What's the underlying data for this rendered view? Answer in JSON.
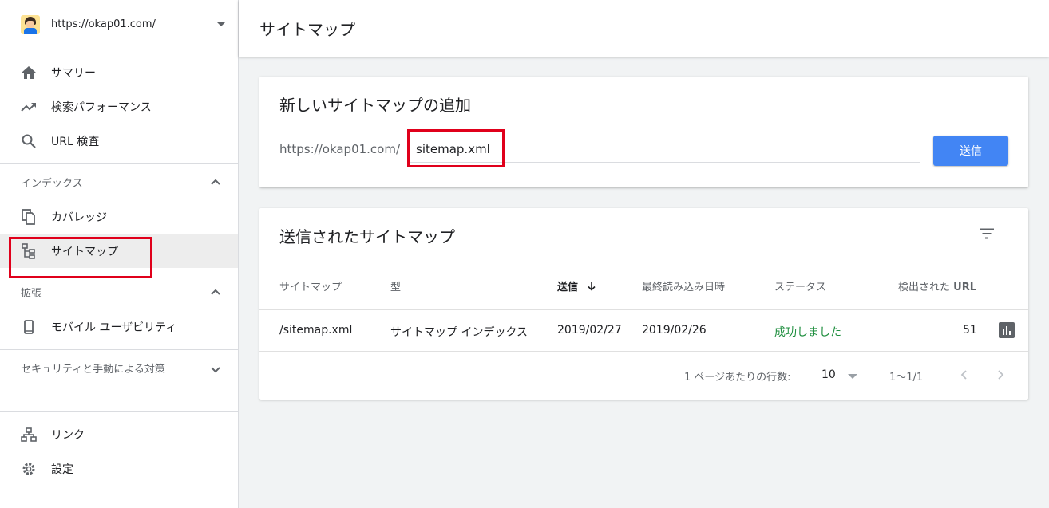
{
  "property": {
    "url": "https://okap01.com/"
  },
  "nav": {
    "summary": "サマリー",
    "performance": "検索パフォーマンス",
    "url_inspection": "URL 検査",
    "index_section": "インデックス",
    "coverage": "カバレッジ",
    "sitemaps": "サイトマップ",
    "enhancements_section": "拡張",
    "mobile_usability": "モバイル ユーザビリティ",
    "security_section": "セキュリティと手動による対策",
    "links": "リンク",
    "settings": "設定"
  },
  "header": {
    "title": "サイトマップ"
  },
  "add_card": {
    "title": "新しいサイトマップの追加",
    "prefix": "https://okap01.com/",
    "input_value": "sitemap.xml",
    "submit_label": "送信"
  },
  "submitted_card": {
    "title": "送信されたサイトマップ",
    "columns": {
      "sitemap": "サイトマップ",
      "type": "型",
      "submitted": "送信",
      "last_read": "最終読み込み日時",
      "status": "ステータス",
      "discovered_prefix": "検出された",
      "discovered_url": "URL"
    },
    "rows": [
      {
        "sitemap": "/sitemap.xml",
        "type": "サイトマップ インデックス",
        "submitted": "2019/02/27",
        "last_read": "2019/02/26",
        "status": "成功しました",
        "discovered": "51"
      }
    ],
    "footer": {
      "rows_per_page_label": "1 ページあたりの行数:",
      "rows_per_page_value": "10",
      "range": "1〜1/1"
    }
  },
  "colors": {
    "accent": "#4285f4",
    "success": "#1e8e3e",
    "highlight": "#e0001b"
  }
}
